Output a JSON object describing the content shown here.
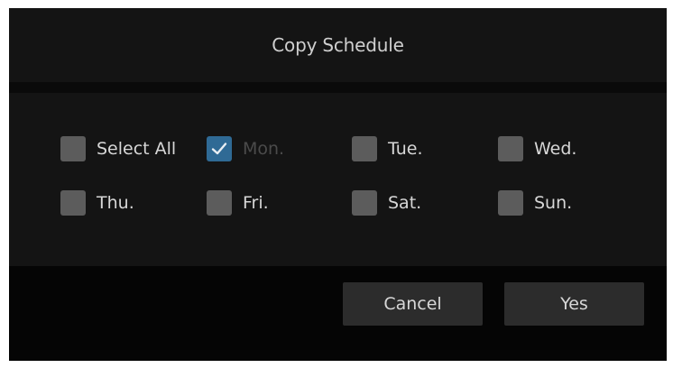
{
  "dialog": {
    "title": "Copy Schedule"
  },
  "options": [
    {
      "label": "Select All",
      "checked": false,
      "disabled": false
    },
    {
      "label": "Mon.",
      "checked": true,
      "disabled": true
    },
    {
      "label": "Tue.",
      "checked": false,
      "disabled": false
    },
    {
      "label": "Wed.",
      "checked": false,
      "disabled": false
    },
    {
      "label": "Thu.",
      "checked": false,
      "disabled": false
    },
    {
      "label": "Fri.",
      "checked": false,
      "disabled": false
    },
    {
      "label": "Sat.",
      "checked": false,
      "disabled": false
    },
    {
      "label": "Sun.",
      "checked": false,
      "disabled": false
    }
  ],
  "buttons": {
    "cancel_label": "Cancel",
    "yes_label": "Yes"
  },
  "colors": {
    "checkbox_checked": "#2f6a95",
    "checkbox_unchecked": "#5c5c5c",
    "dialog_background": "#141414",
    "button_background": "#2c2c2c"
  },
  "icons": {
    "checkmark": "checkmark-icon"
  }
}
